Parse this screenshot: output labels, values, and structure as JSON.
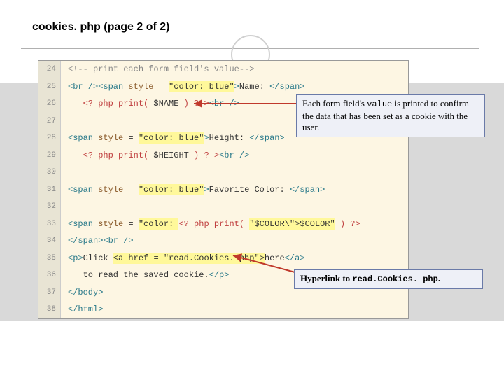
{
  "title": "cookies. php (page 2 of 2)",
  "code_lines": [
    {
      "n": 24,
      "raw": "<!-- print each form field's value-->"
    },
    {
      "n": 25,
      "raw": "<br /><span style = \"color: blue\">Name: </span>"
    },
    {
      "n": 26,
      "raw": "   <? php print( $NAME ) ? ><br />"
    },
    {
      "n": 27,
      "raw": ""
    },
    {
      "n": 28,
      "raw": "<span style = \"color: blue\">Height: </span>"
    },
    {
      "n": 29,
      "raw": "   <? php print( $HEIGHT ) ? ><br />"
    },
    {
      "n": 30,
      "raw": ""
    },
    {
      "n": 31,
      "raw": "<span style = \"color: blue\">Favorite Color: </span>"
    },
    {
      "n": 32,
      "raw": ""
    },
    {
      "n": 33,
      "raw": "<span style = \"color: <? php print( \"$COLOR\\\">$COLOR\" ) ?>"
    },
    {
      "n": 34,
      "raw": "</span><br />"
    },
    {
      "n": 35,
      "raw": "<p>Click <a href = \"read.Cookies. php\">here</a>"
    },
    {
      "n": 36,
      "raw": "   to read the saved cookie.</p>"
    },
    {
      "n": 37,
      "raw": "</body>"
    },
    {
      "n": 38,
      "raw": "</html>"
    }
  ],
  "callout1": {
    "prefix": "Each form field's ",
    "value_word": "value",
    "suffix": " is printed to confirm the data that has been set as a cookie with the user."
  },
  "callout2": {
    "prefix": "Hyperlink to ",
    "file": "read.Cookies. php",
    "suffix": "."
  },
  "colors": {
    "code_bg": "#fdf6e3",
    "string_hl": "#fff89a",
    "callout_bg": "#eef0f7",
    "callout_border": "#6a7aa8",
    "arrow": "#c0392b"
  }
}
